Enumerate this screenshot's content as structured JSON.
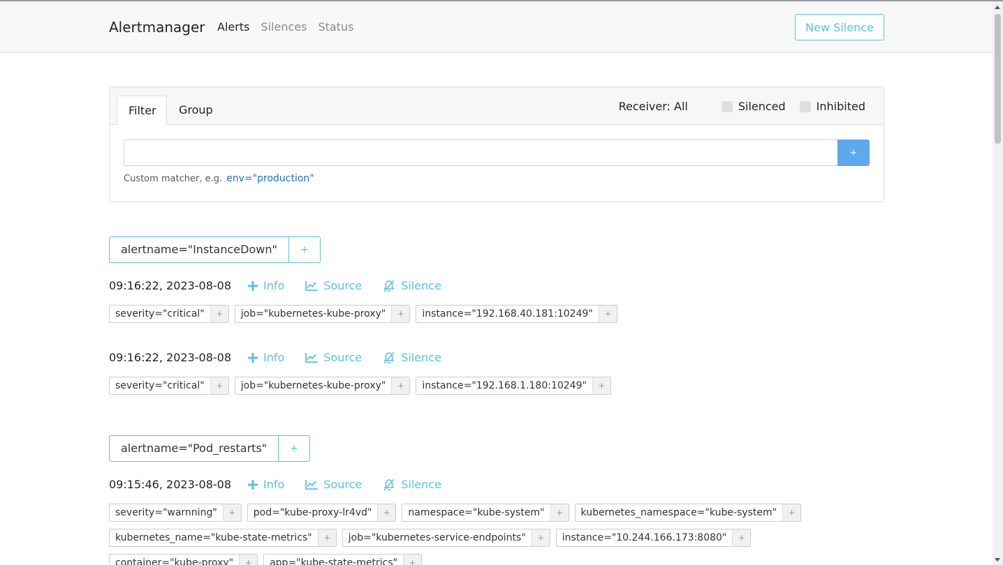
{
  "navbar": {
    "brand": "Alertmanager",
    "links": [
      {
        "label": "Alerts",
        "active": true
      },
      {
        "label": "Silences",
        "active": false
      },
      {
        "label": "Status",
        "active": false
      }
    ],
    "new_silence": "New Silence"
  },
  "filter_card": {
    "tabs": [
      "Filter",
      "Group"
    ],
    "receiver": "Receiver: All",
    "silenced": "Silenced",
    "inhibited": "Inhibited",
    "input_value": "",
    "plus": "+",
    "hint": "Custom matcher, e.g.",
    "hint_example": "env=\"production\""
  },
  "actions": {
    "info": "Info",
    "source": "Source",
    "silence": "Silence"
  },
  "colors": {
    "accent": "#5bc0de",
    "primary": "#5ea9ea"
  },
  "groups": [
    {
      "label": "alertname=\"InstanceDown\"",
      "plus": "+",
      "alerts": [
        {
          "time": "09:16:22, 2023-08-08",
          "labels": [
            "severity=\"critical\"",
            "job=\"kubernetes-kube-proxy\"",
            "instance=\"192.168.40.181:10249\""
          ]
        },
        {
          "time": "09:16:22, 2023-08-08",
          "labels": [
            "severity=\"critical\"",
            "job=\"kubernetes-kube-proxy\"",
            "instance=\"192.168.1.180:10249\""
          ]
        }
      ]
    },
    {
      "label": "alertname=\"Pod_restarts\"",
      "plus": "+",
      "alerts": [
        {
          "time": "09:15:46, 2023-08-08",
          "labels": [
            "severity=\"warnning\"",
            "pod=\"kube-proxy-lr4vd\"",
            "namespace=\"kube-system\"",
            "kubernetes_namespace=\"kube-system\"",
            "kubernetes_name=\"kube-state-metrics\"",
            "job=\"kubernetes-service-endpoints\"",
            "instance=\"10.244.166.173:8080\"",
            "container=\"kube-proxy\"",
            "app=\"kube-state-metrics\""
          ]
        }
      ]
    }
  ],
  "chip_plus": "+"
}
